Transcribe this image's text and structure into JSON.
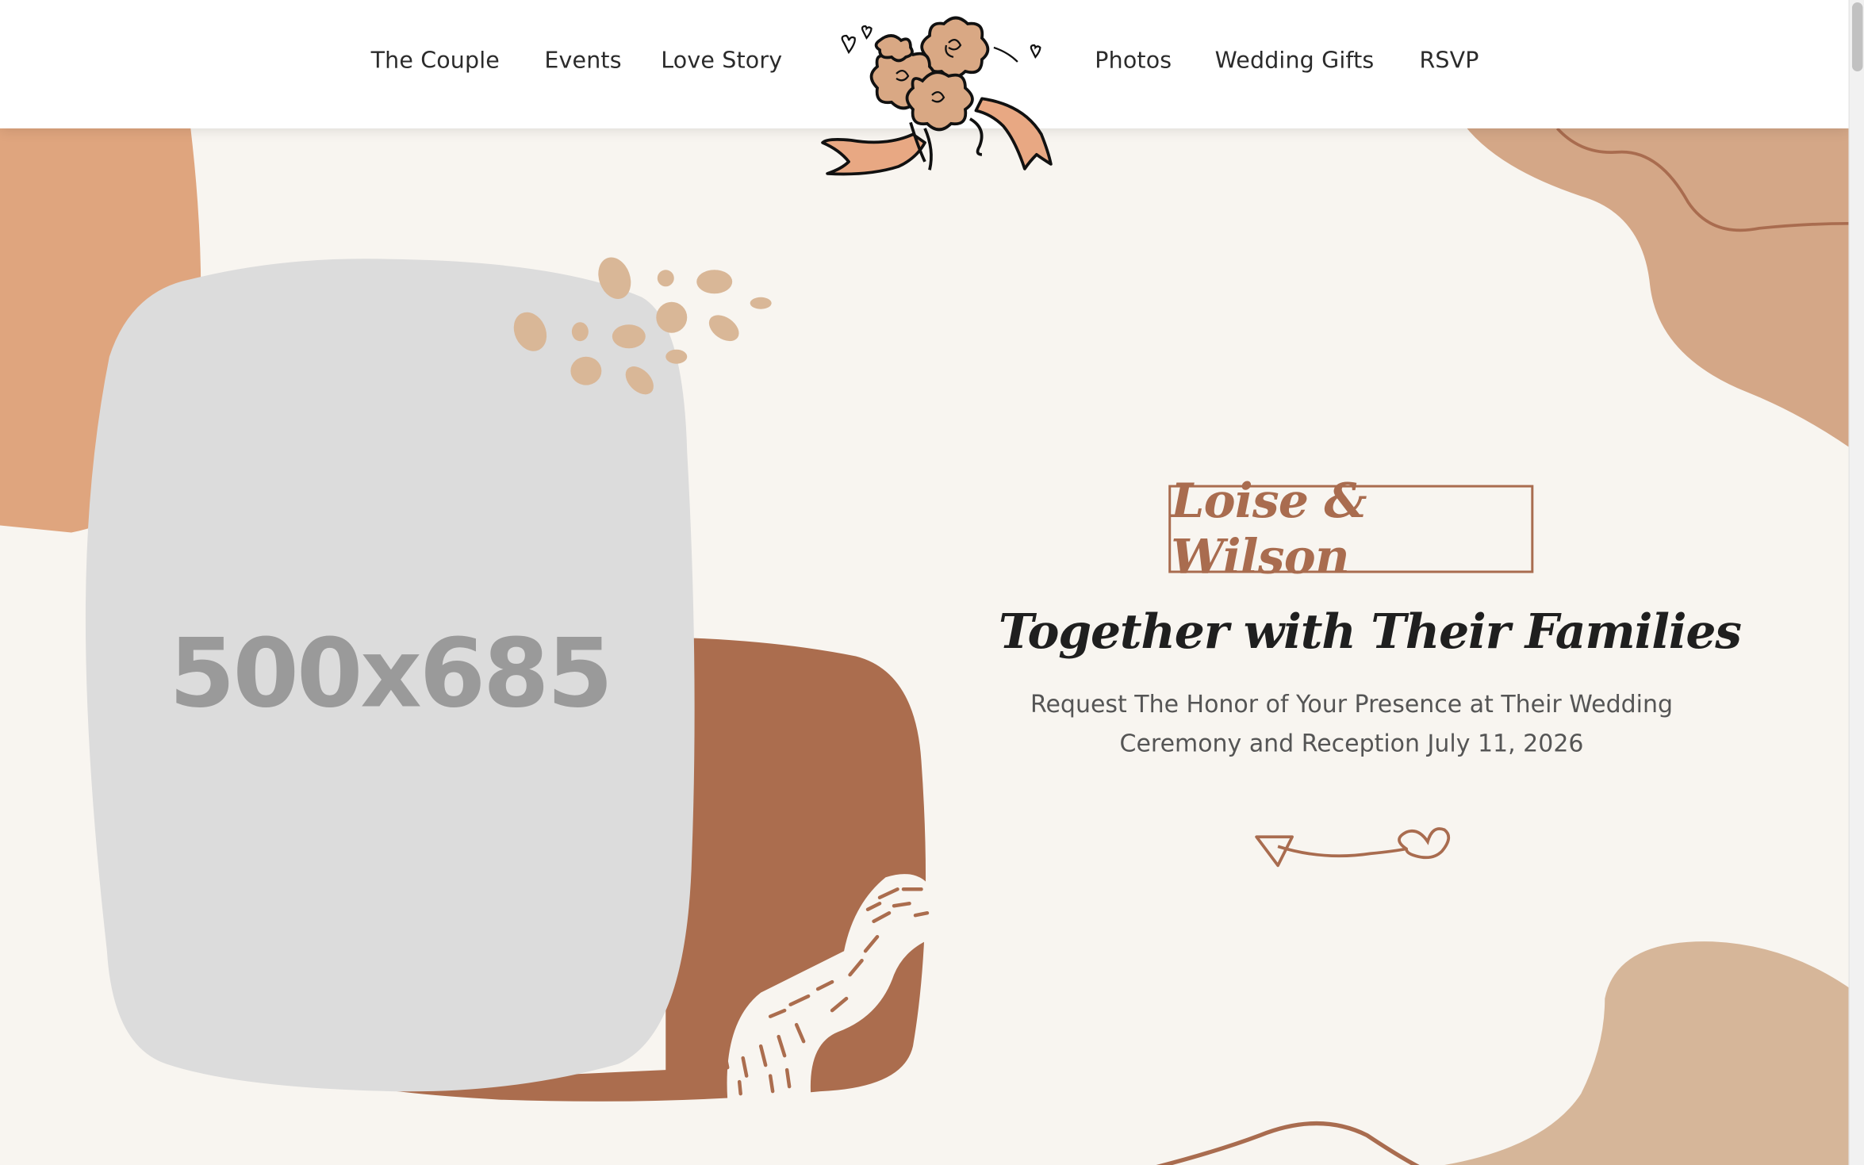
{
  "header": {
    "nav_left": [
      {
        "label": "The Couple"
      },
      {
        "label": "Events"
      },
      {
        "label": "Love Story"
      }
    ],
    "nav_right": [
      {
        "label": "Photos"
      },
      {
        "label": "Wedding Gifts"
      },
      {
        "label": "RSVP"
      }
    ],
    "logo_icon": "flower-bouquet-icon"
  },
  "hero": {
    "image_placeholder": "500x685",
    "names": "Loise & Wilson",
    "subtitle": "Together with Their Families",
    "invite_line_1": "Request The Honor of Your Presence at Their Wedding",
    "invite_line_2": "Ceremony and Reception July 11, 2026",
    "divider_icon": "arrow-divider-icon"
  },
  "colors": {
    "background": "#f8f5f0",
    "accent_brown": "#a96c4f",
    "terracotta": "#df a57e",
    "tan": "#d4ae90",
    "placeholder_gray": "#dcdcdc"
  }
}
